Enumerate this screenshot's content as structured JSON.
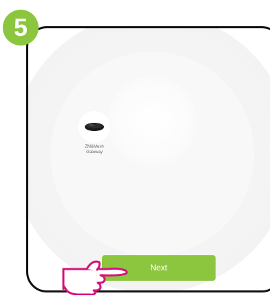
{
  "step": {
    "number": "5",
    "badge_color": "#8cc63f"
  },
  "device": {
    "name": "ZM&Mesh\nGateway",
    "icon": "gateway-hub-icon"
  },
  "actions": {
    "next_label": "Next",
    "next_color": "#8cc63f"
  },
  "annotation": {
    "pointer_icon": "hand-pointer-icon",
    "pointer_color": "#d6127a"
  }
}
